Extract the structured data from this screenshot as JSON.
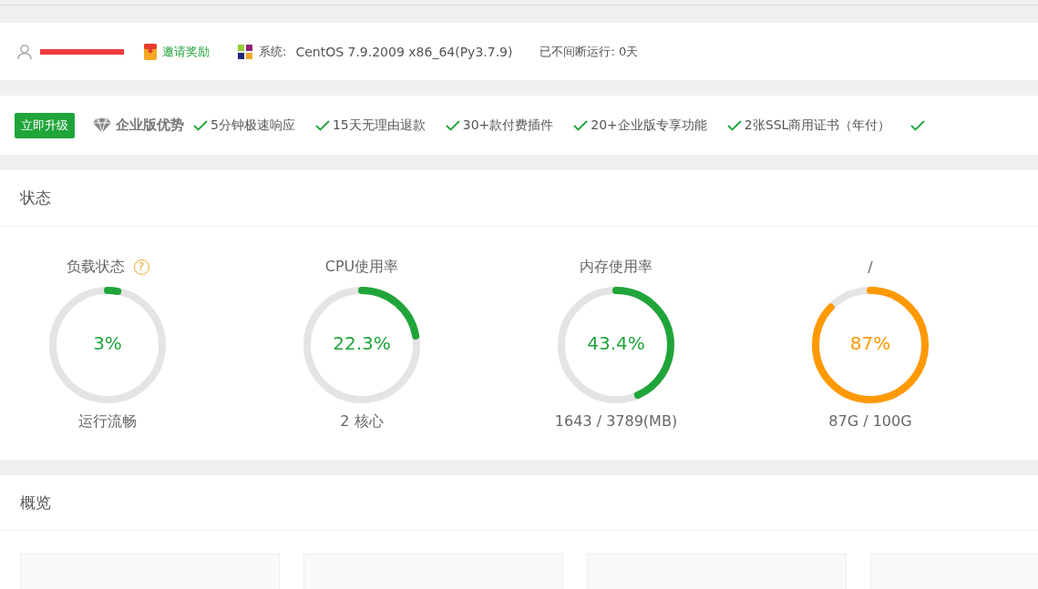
{
  "header": {
    "user_redacted": true,
    "invite": "邀请奖励",
    "system_label": "系统:",
    "system_value": "CentOS 7.9.2009 x86_64(Py3.7.9)",
    "uptime": "已不间断运行: 0天"
  },
  "upgrade": {
    "button": "立即升级",
    "title": "企业版优势",
    "features": [
      "5分钟极速响应",
      "15天无理由退款",
      "30+款付费插件",
      "20+企业版专享功能",
      "2张SSL商用证书（年付）"
    ],
    "trailing_check": true
  },
  "status": {
    "title": "状态",
    "gauges": [
      {
        "title": "负载状态",
        "help": "?",
        "value": "3%",
        "level": 0.03,
        "color": "#20a53a",
        "caption": "运行流畅"
      },
      {
        "title": "CPU使用率",
        "value": "22.3%",
        "level": 0.223,
        "color": "#20a53a",
        "caption": "2 核心"
      },
      {
        "title": "内存使用率",
        "value": "43.4%",
        "level": 0.434,
        "color": "#20a53a",
        "caption": "1643 / 3789(MB)"
      },
      {
        "title": "/",
        "value": "87%",
        "level": 0.87,
        "color": "#ff9900",
        "caption": "87G / 100G"
      }
    ]
  },
  "overview": {
    "title": "概览",
    "cards": [
      {
        "kind": "tile"
      },
      {
        "kind": "tile"
      },
      {
        "kind": "tile"
      },
      {
        "kind": "tile"
      }
    ]
  }
}
